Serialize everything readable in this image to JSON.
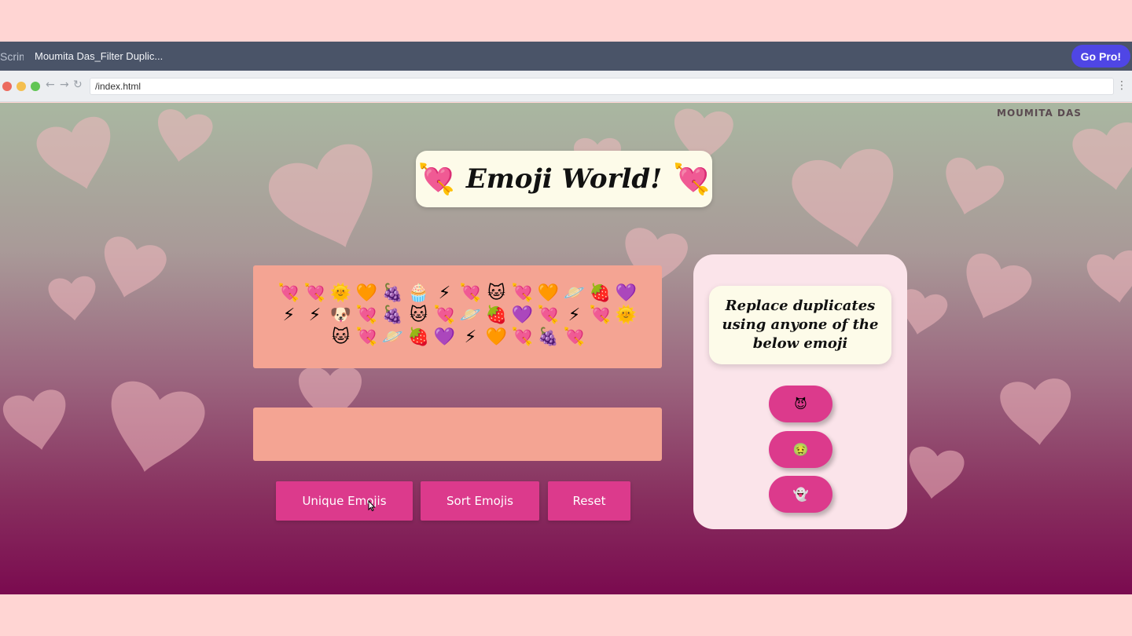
{
  "appbar": {
    "brand": "Scrim",
    "tab_title": "Moumita Das_Filter Duplic...",
    "gopro_label": "Go Pro!"
  },
  "browser": {
    "url": "/index.html",
    "back_icon": "←",
    "forward_icon": "→",
    "reload_icon": "↻",
    "menu_icon": "⋮"
  },
  "page": {
    "author": "MOUMITA DAS",
    "title": {
      "left_emoji": "💘",
      "text": "Emoji World!",
      "right_emoji": "💘"
    },
    "emojis": [
      "💘",
      "💘",
      "🌞",
      "🧡",
      "🍇",
      "🧁",
      "⚡",
      "💘",
      "🐱",
      "💘",
      "🧡",
      "🪐",
      "🍓",
      "💜",
      "⚡",
      "⚡",
      "🐶",
      "💘",
      "🍇",
      "🐱",
      "💘",
      "🪐",
      "🍓",
      "💜",
      "💘",
      "⚡",
      "💘",
      "🌞",
      "🐱",
      "💘",
      "🪐",
      "🍓",
      "💜",
      "⚡",
      "🧡",
      "💘",
      "🍇",
      "💘"
    ],
    "result": "",
    "buttons": {
      "unique": "Unique Emojis",
      "sort": "Sort Emojis",
      "reset": "Reset"
    }
  },
  "side": {
    "instruction": "Replace duplicates using anyone of the below emoji",
    "options": [
      "😈",
      "🤢",
      "👻"
    ]
  },
  "colors": {
    "accent": "#dc3a8c",
    "box": "#f4a493",
    "card": "#fdfbe9",
    "panel": "#fbe4ea",
    "gopro": "#4f46e5"
  }
}
